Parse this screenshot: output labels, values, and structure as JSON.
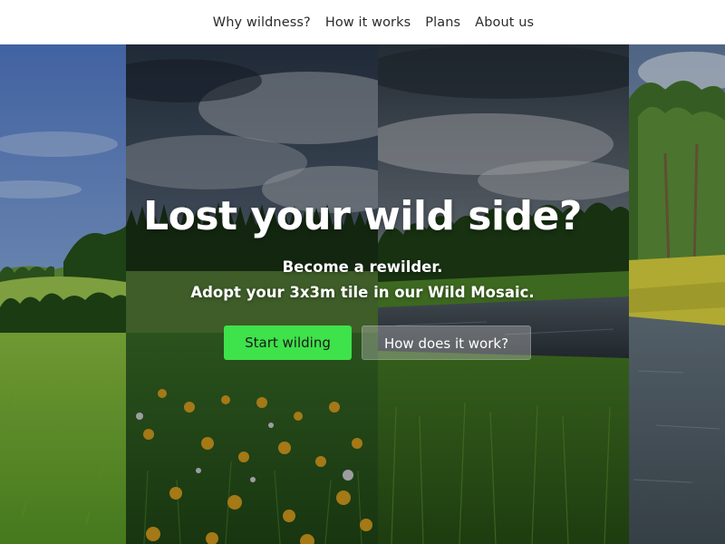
{
  "nav": {
    "items": [
      {
        "label": "Why wildness?"
      },
      {
        "label": "How it works"
      },
      {
        "label": "Plans"
      },
      {
        "label": "About us"
      }
    ]
  },
  "hero": {
    "headline": "Lost your wild side?",
    "subline_1": "Become a rewilder.",
    "subline_2": "Adopt your 3x3m tile in our Wild Mosaic.",
    "primary_button": "Start wilding",
    "secondary_button": "How does it work?"
  },
  "colors": {
    "primary_button_bg": "#3ee24a",
    "header_bg": "#ffffff",
    "nav_text": "#2b2b2b"
  }
}
